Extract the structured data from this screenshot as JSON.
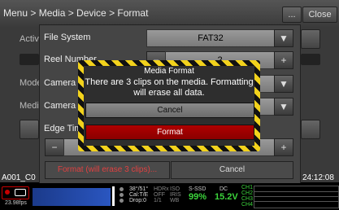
{
  "header": {
    "breadcrumb": "Menu > Media > Device > Format",
    "more_label": "...",
    "close_label": "Close"
  },
  "background_menu": {
    "side_labels": [
      "Active",
      "Mode",
      "Media"
    ],
    "rows": [
      {
        "label": "File System",
        "value": "FAT32"
      },
      {
        "label": "Reel Number",
        "value": "2"
      },
      {
        "label": "Camera ID",
        "value": ""
      },
      {
        "label": "Camera Position",
        "value": ""
      },
      {
        "label": "Edge Timecode",
        "value": ""
      }
    ],
    "format_button": "Format (will erase 3 clips)...",
    "cancel_button": "Cancel",
    "minus_glyph": "−",
    "plus_glyph": "+",
    "down_glyph": "▼"
  },
  "dialog": {
    "title": "Media Format",
    "message": "There are 3 clips on the media. Formatting will erase all data.",
    "cancel_label": "Cancel",
    "format_label": "Format"
  },
  "status": {
    "clip_name": "A001_C0",
    "timecode": "24:12:08",
    "fps": "23.98fps",
    "left_labels": [
      "38°/51°",
      "Cal:T/E",
      "Drop:0"
    ],
    "mid_labels": [
      "HDRx",
      "OFF",
      "1/1"
    ],
    "mid2_labels": [
      "ISO",
      "IRIS",
      "WB"
    ],
    "media_label": "S-SSD",
    "media_pct": "99%",
    "dc_label": "DC",
    "voltage": "15.2V",
    "ch_labels": [
      "CH1",
      "CH2",
      "CH3",
      "CH4"
    ],
    "accent_green": "#3cd53c",
    "accent_yellow": "#f2d21c",
    "accent_red": "#c80000"
  }
}
